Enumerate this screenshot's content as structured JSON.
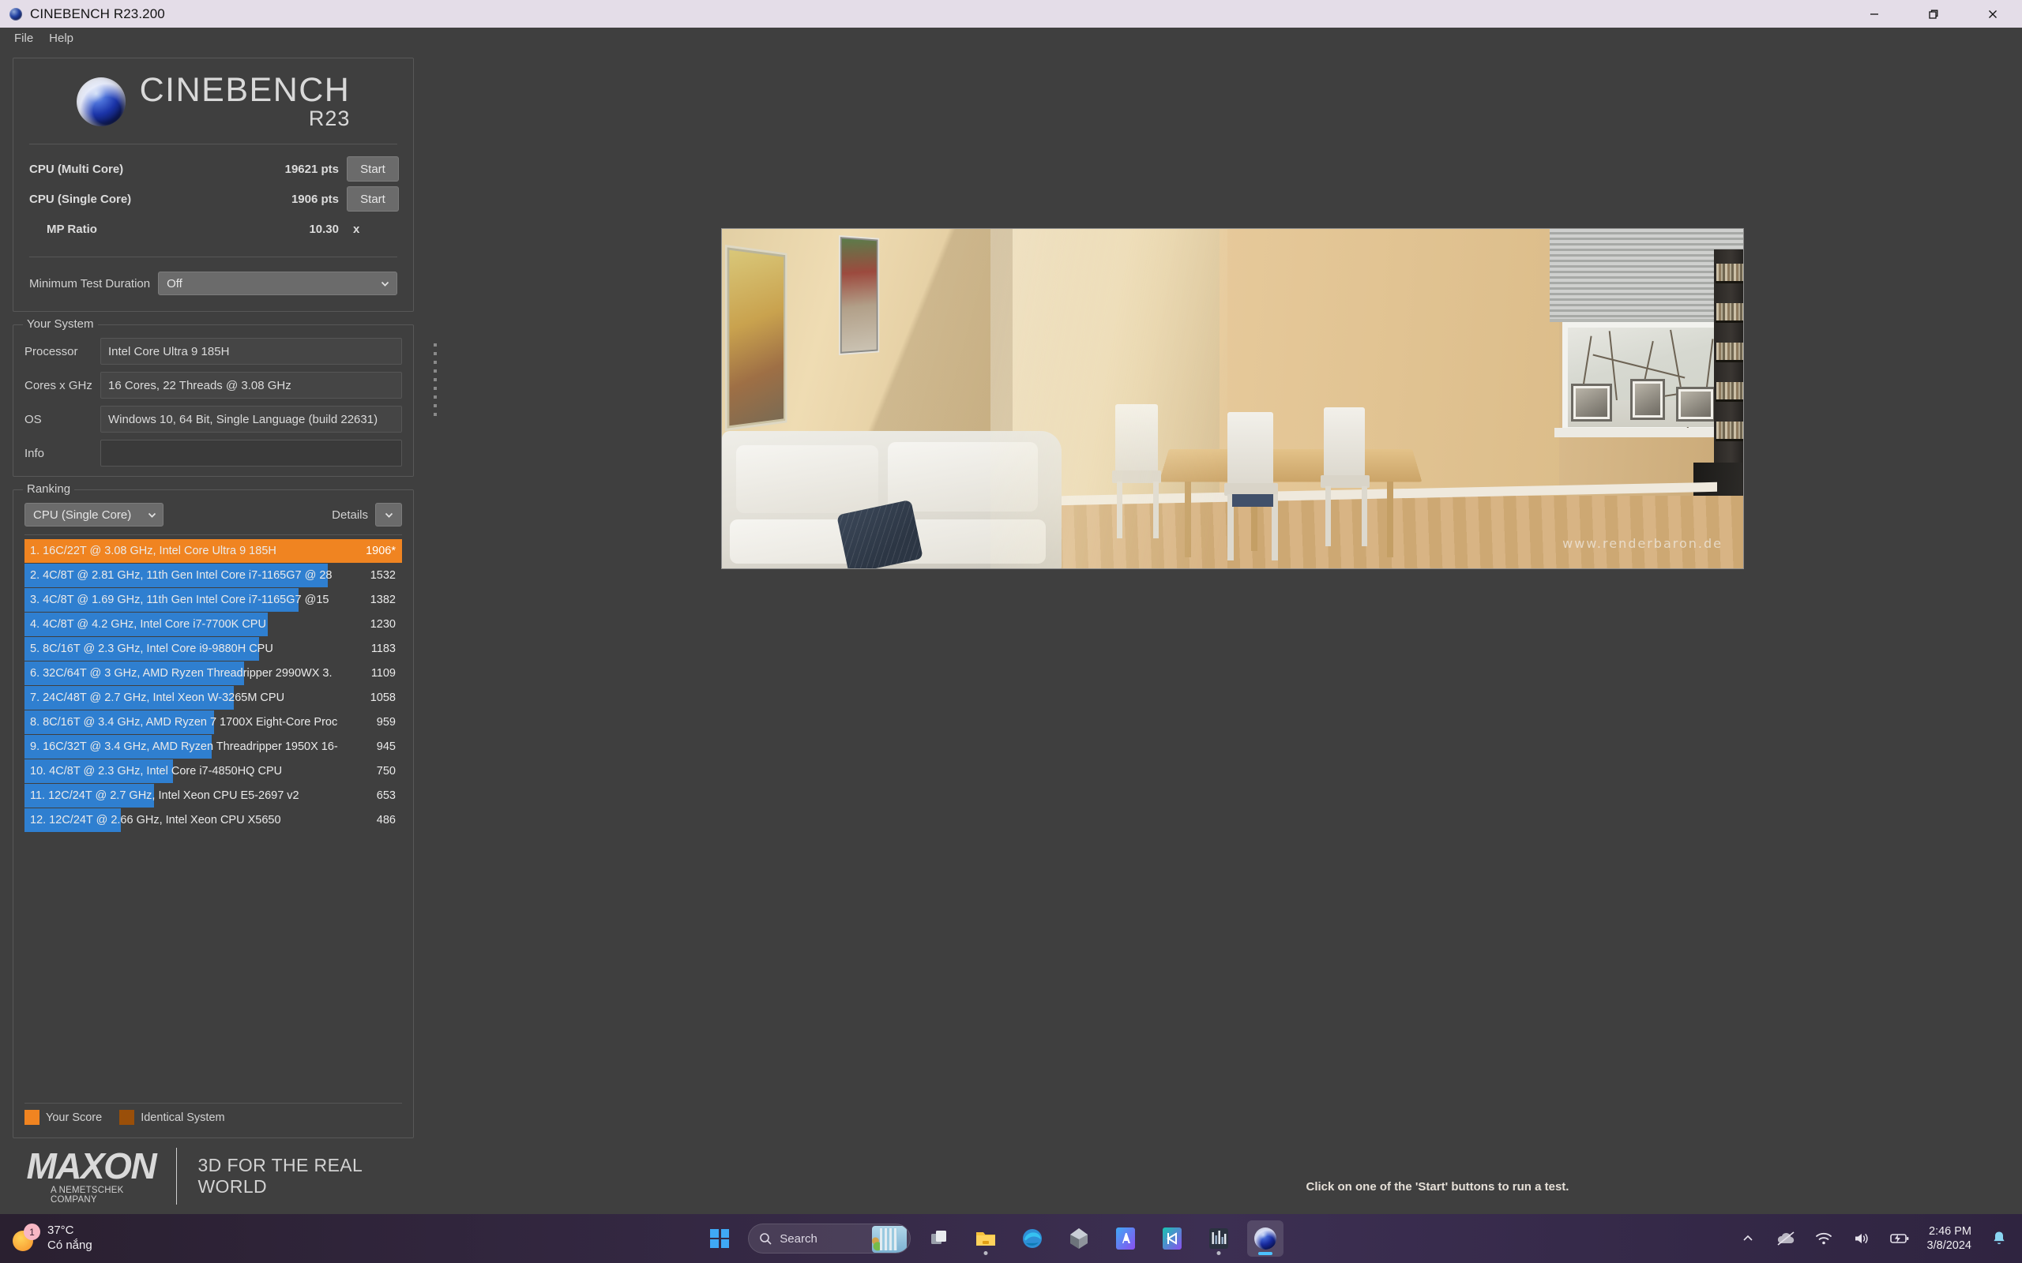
{
  "window": {
    "title": "CINEBENCH R23.200",
    "minimize": "minimize",
    "maximize": "restore",
    "close": "close"
  },
  "menu": {
    "items": [
      "File",
      "Help"
    ]
  },
  "logo": {
    "main": "CINEBENCH",
    "sub": "R23"
  },
  "scores": {
    "multi": {
      "label": "CPU (Multi Core)",
      "value": "19621 pts",
      "button": "Start"
    },
    "single": {
      "label": "CPU (Single Core)",
      "value": "1906 pts",
      "button": "Start"
    },
    "ratio": {
      "label": "MP Ratio",
      "value": "10.30",
      "unit": "x"
    }
  },
  "duration": {
    "label": "Minimum Test Duration",
    "value": "Off"
  },
  "system": {
    "title": "Your System",
    "fields": [
      {
        "label": "Processor",
        "value": "Intel Core Ultra 9 185H"
      },
      {
        "label": "Cores x GHz",
        "value": "16 Cores, 22 Threads @ 3.08 GHz"
      },
      {
        "label": "OS",
        "value": "Windows 10, 64 Bit, Single Language (build 22631)"
      },
      {
        "label": "Info",
        "value": ""
      }
    ]
  },
  "ranking": {
    "title": "Ranking",
    "mode": "CPU (Single Core)",
    "details_label": "Details",
    "legend": [
      {
        "label": "Your Score",
        "color": "#f08421"
      },
      {
        "label": "Identical System",
        "color": "#9a4f09"
      }
    ],
    "rows": [
      {
        "rank": 1,
        "text": "1. 16C/22T @ 3.08 GHz, Intel Core Ultra 9 185H",
        "score": "1906*",
        "bar_pct": 100,
        "mine": true
      },
      {
        "rank": 2,
        "text": "2. 4C/8T @ 2.81 GHz, 11th Gen Intel Core i7-1165G7 @ 28",
        "score": "1532",
        "bar_pct": 80.4,
        "mine": false
      },
      {
        "rank": 3,
        "text": "3. 4C/8T @ 1.69 GHz, 11th Gen Intel Core i7-1165G7 @15",
        "score": "1382",
        "bar_pct": 72.5,
        "mine": false
      },
      {
        "rank": 4,
        "text": "4. 4C/8T @ 4.2 GHz, Intel Core i7-7700K CPU",
        "score": "1230",
        "bar_pct": 64.5,
        "mine": false
      },
      {
        "rank": 5,
        "text": "5. 8C/16T @ 2.3 GHz, Intel Core i9-9880H CPU",
        "score": "1183",
        "bar_pct": 62.1,
        "mine": false
      },
      {
        "rank": 6,
        "text": "6. 32C/64T @ 3 GHz, AMD Ryzen Threadripper 2990WX 3.",
        "score": "1109",
        "bar_pct": 58.2,
        "mine": false
      },
      {
        "rank": 7,
        "text": "7. 24C/48T @ 2.7 GHz, Intel Xeon W-3265M CPU",
        "score": "1058",
        "bar_pct": 55.5,
        "mine": false
      },
      {
        "rank": 8,
        "text": "8. 8C/16T @ 3.4 GHz, AMD Ryzen 7 1700X Eight-Core Proc",
        "score": "959",
        "bar_pct": 50.3,
        "mine": false
      },
      {
        "rank": 9,
        "text": "9. 16C/32T @ 3.4 GHz, AMD Ryzen Threadripper 1950X 16-",
        "score": "945",
        "bar_pct": 49.6,
        "mine": false
      },
      {
        "rank": 10,
        "text": "10. 4C/8T @ 2.3 GHz, Intel Core i7-4850HQ CPU",
        "score": "750",
        "bar_pct": 39.4,
        "mine": false
      },
      {
        "rank": 11,
        "text": "11. 12C/24T @ 2.7 GHz, Intel Xeon CPU E5-2697 v2",
        "score": "653",
        "bar_pct": 34.3,
        "mine": false
      },
      {
        "rank": 12,
        "text": "12. 12C/24T @ 2.66 GHz, Intel Xeon CPU X5650",
        "score": "486",
        "bar_pct": 25.5,
        "mine": false
      }
    ]
  },
  "footer": {
    "brand": "MAXON",
    "brand_tagline": "A NEMETSCHEK COMPANY",
    "slogan": "3D FOR THE REAL WORLD"
  },
  "status": {
    "text": "Click on one of the 'Start' buttons to run a test."
  },
  "render": {
    "watermark": "www.renderbaron.de"
  },
  "taskbar": {
    "weather": {
      "temp": "37°C",
      "condition": "Có nắng",
      "badge": "1"
    },
    "search": {
      "placeholder": "Search",
      "label": "Search"
    },
    "apps": [
      {
        "name": "start-button"
      },
      {
        "name": "task-view-button"
      },
      {
        "name": "file-explorer-button"
      },
      {
        "name": "edge-browser-button"
      },
      {
        "name": "3d-viewer-button"
      },
      {
        "name": "ai-app-button"
      },
      {
        "name": "media-app-button"
      },
      {
        "name": "performance-monitor-button"
      },
      {
        "name": "cinebench-taskbar-button"
      }
    ],
    "clock": {
      "time": "2:46 PM",
      "date": "3/8/2024"
    }
  },
  "colors": {
    "accent_orange": "#f08421",
    "bar_blue": "#2f7fd0",
    "identical_brown": "#9a4f09",
    "panel_bg": "#3f3f3f"
  }
}
